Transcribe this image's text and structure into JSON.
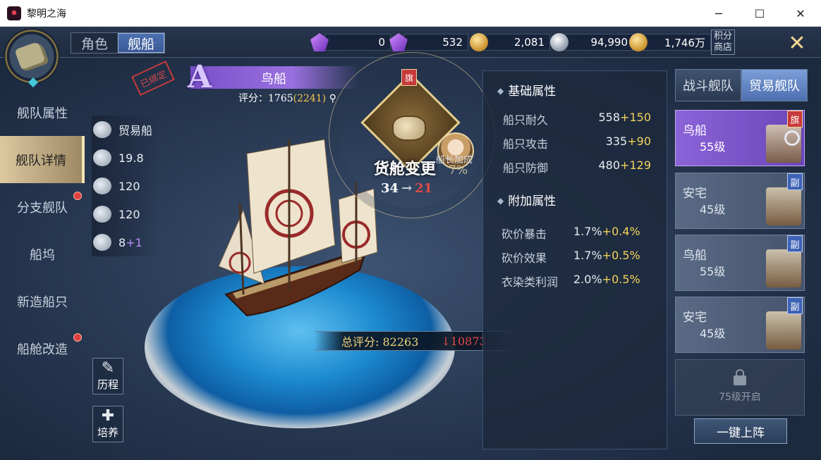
{
  "window": {
    "title": "黎明之海",
    "min": "─",
    "max": "☐",
    "close": "✕"
  },
  "top_tabs": [
    {
      "label": "角色"
    },
    {
      "label": "舰船"
    }
  ],
  "currencies": [
    {
      "icon": "purple-gem-icon",
      "value": "0"
    },
    {
      "icon": "bound-gem-icon",
      "value": "532"
    },
    {
      "icon": "gold-coin-icon",
      "value": "2,081"
    },
    {
      "icon": "silver-coin-icon",
      "value": "94,990"
    },
    {
      "icon": "gold-pile-icon",
      "value": "1,746万"
    }
  ],
  "shop_label": "积分商店",
  "close_icon": "✕",
  "left_nav": [
    {
      "label": "舰队属性",
      "active": false,
      "dot": false
    },
    {
      "label": "舰队详情",
      "active": true,
      "dot": false
    },
    {
      "label": "分支舰队",
      "active": false,
      "dot": true
    },
    {
      "label": "船坞",
      "active": false,
      "dot": false
    },
    {
      "label": "新造船只",
      "active": false,
      "dot": false
    },
    {
      "label": "船舱改造",
      "active": false,
      "dot": true
    }
  ],
  "ship_attrs": [
    {
      "icon": "ship-type-icon",
      "text": "贸易船"
    },
    {
      "icon": "speed-icon",
      "text": "19.8"
    },
    {
      "icon": "cargo-icon",
      "text": "120"
    },
    {
      "icon": "crew-icon",
      "text": "120"
    },
    {
      "icon": "cannon-icon",
      "text": "8",
      "bonus": "+1"
    }
  ],
  "side_buttons": [
    {
      "label": "历程",
      "glyph": "✎"
    },
    {
      "label": "培养",
      "glyph": "✚"
    }
  ],
  "bound_stamp": "已绑定",
  "ship": {
    "grade": "A",
    "name": "鸟船",
    "score_label": "评分：",
    "score": "1765",
    "score_potential": "(2241)"
  },
  "total_score": {
    "label": "总评分: 82263",
    "change": "10873",
    "arrow": "↓"
  },
  "popup": {
    "flag": "旗",
    "title": "货舱变更",
    "captain_label": "船长加成",
    "pct": "7%",
    "from": "34",
    "to": "21",
    "arrow": "→"
  },
  "base_section": {
    "title": "基础属性",
    "stats": [
      {
        "label": "船只耐久",
        "value": "558",
        "add": "+150"
      },
      {
        "label": "船只攻击",
        "value": "335",
        "add": "+90"
      },
      {
        "label": "船只防御",
        "value": "480",
        "add": "+129"
      }
    ]
  },
  "extra_section": {
    "title": "附加属性",
    "stats": [
      {
        "label": "砍价暴击",
        "value": "1.7%",
        "add": "+0.4%"
      },
      {
        "label": "砍价效果",
        "value": "1.7%",
        "add": "+0.5%"
      },
      {
        "label": "衣染类利润",
        "value": "2.0%",
        "add": "+0.5%"
      }
    ]
  },
  "fleet_tabs": [
    {
      "label": "战斗舰队"
    },
    {
      "label": "贸易舰队"
    }
  ],
  "fleet_ships": [
    {
      "name": "鸟船",
      "level": "55级",
      "badge": "旗",
      "active": true
    },
    {
      "name": "安宅",
      "level": "45级",
      "badge": "副",
      "active": false
    },
    {
      "name": "鸟船",
      "level": "55级",
      "badge": "副",
      "active": false
    },
    {
      "name": "安宅",
      "level": "45级",
      "badge": "副",
      "active": false
    }
  ],
  "locked_slot": "75级开启",
  "deploy_button": "一键上阵",
  "colors": {
    "accent_purple": "#8b63d8",
    "gold": "#f2d25a",
    "red": "#e04a4a"
  }
}
